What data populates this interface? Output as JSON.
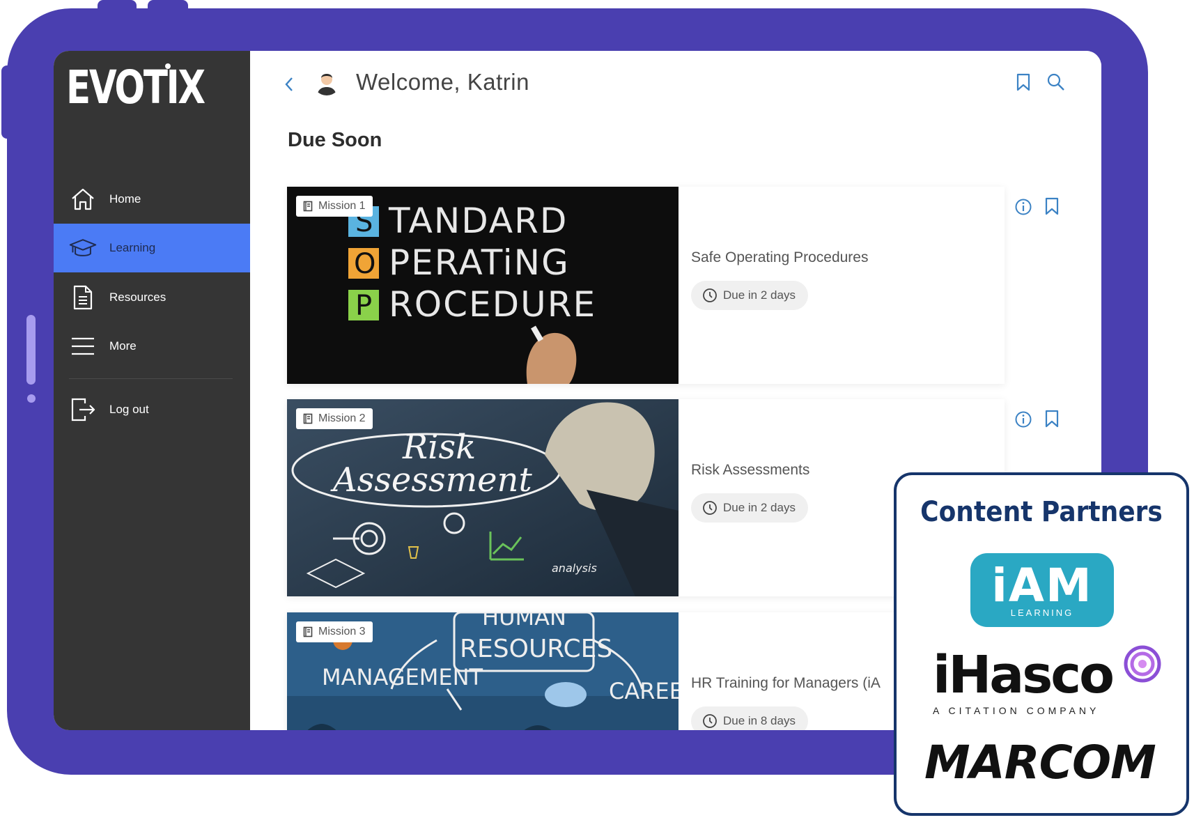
{
  "brand": {
    "logo_text": "EVOTIX"
  },
  "sidebar": {
    "items": [
      {
        "label": "Home",
        "icon": "home-icon"
      },
      {
        "label": "Learning",
        "icon": "graduation-cap-icon",
        "active": true
      },
      {
        "label": "Resources",
        "icon": "document-icon"
      },
      {
        "label": "More",
        "icon": "menu-icon"
      },
      {
        "label": "Log out",
        "icon": "logout-icon"
      }
    ]
  },
  "header": {
    "welcome": "Welcome, Katrin"
  },
  "main": {
    "section_title": "Due Soon",
    "cards": [
      {
        "badge": "Mission 1",
        "title": "Safe Operating Procedures",
        "due": "Due in 2 days",
        "thumb_lines": [
          "TANDARD",
          "PERATiNG",
          "ROCEDURE"
        ],
        "thumb_letters": [
          "S",
          "O",
          "P"
        ]
      },
      {
        "badge": "Mission 2",
        "title": "Risk Assessments",
        "due": "Due in 2 days",
        "thumb_lines": [
          "Risk",
          "Assessment",
          "analysis"
        ]
      },
      {
        "badge": "Mission 3",
        "title": "HR Training for Managers (iA",
        "due": "Due in 8 days",
        "thumb_lines": [
          "HUMAN",
          "RESOURCES",
          "MANAGEMENT",
          "CAREEF"
        ]
      }
    ]
  },
  "partners": {
    "title": "Content Partners",
    "iam_main": "iAM",
    "iam_sub": "LEARNING",
    "ihasco_main": "iHasco",
    "ihasco_sub": "A CITATION COMPANY",
    "marcom": "MARCOM"
  },
  "colors": {
    "frame": "#4a3fb0",
    "sidebar": "#353535",
    "active_nav": "#4b7bf5",
    "accent_icon": "#3b82c4",
    "partners_navy": "#16356b",
    "iam_teal": "#2aa8c3"
  }
}
